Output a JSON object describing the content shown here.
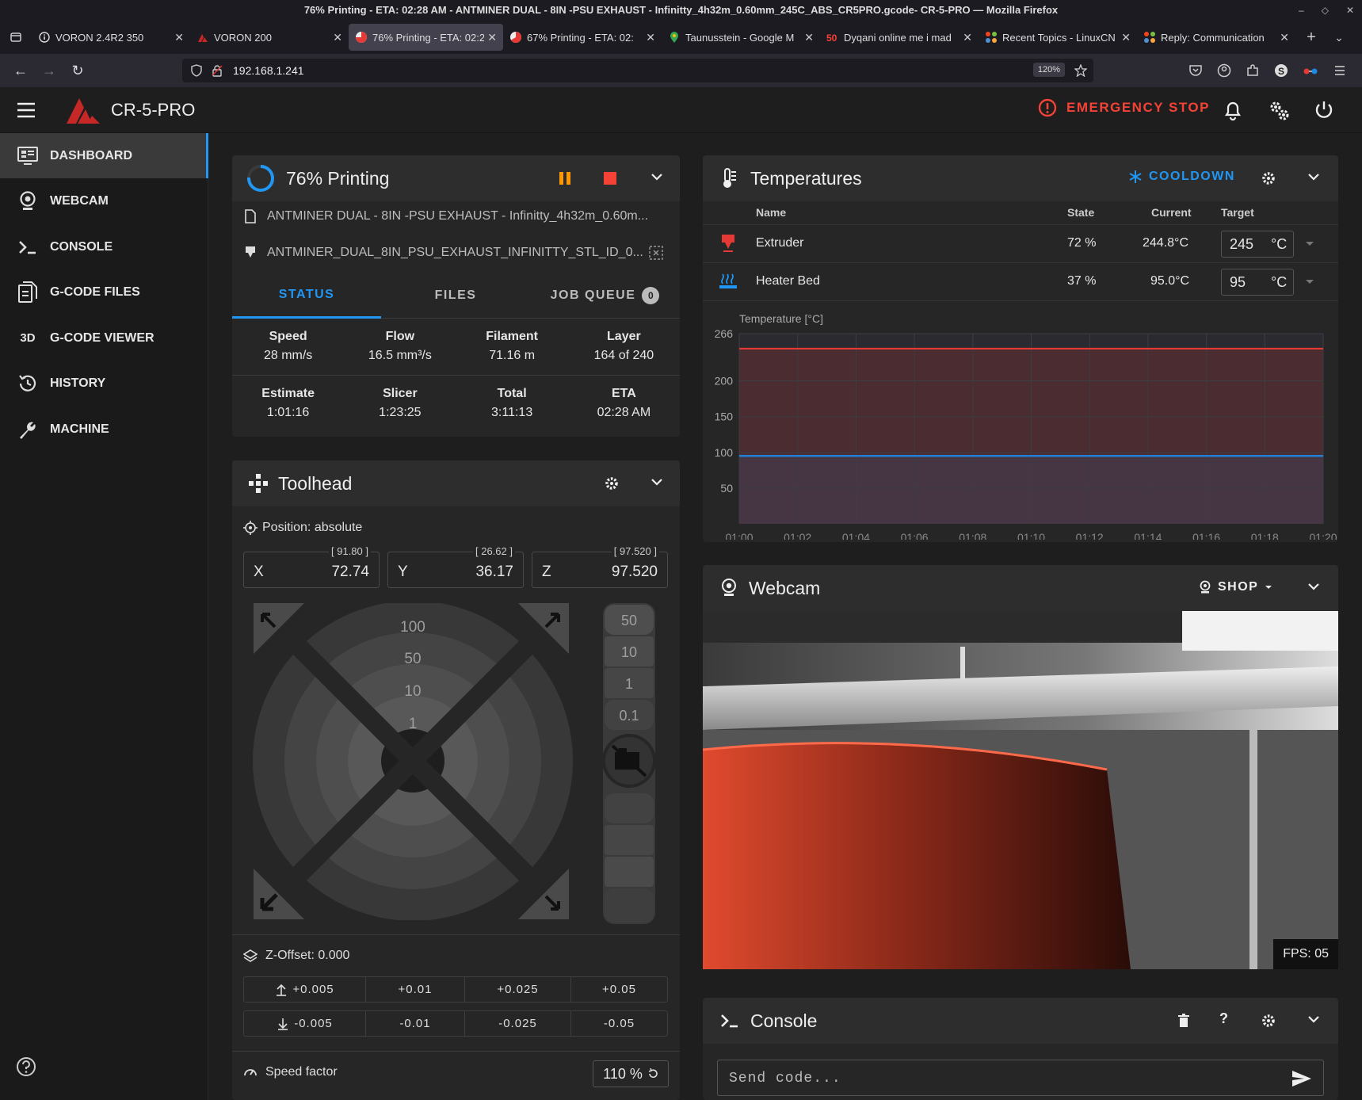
{
  "browser": {
    "window_title": "76% Printing - ETA: 02:28 AM - ANTMINER DUAL - 8IN -PSU EXHAUST - Infinitty_4h32m_0.60mm_245C_ABS_CR5PRO.gcode- CR-5-PRO — Mozilla Firefox",
    "tabs": [
      {
        "label": "VORON 2.4R2 350"
      },
      {
        "label": "VORON 200"
      },
      {
        "label": "76% Printing - ETA: 02:2"
      },
      {
        "label": "67% Printing - ETA: 02:"
      },
      {
        "label": "Taunusstein - Google M"
      },
      {
        "label": "Dyqani online me i mad"
      },
      {
        "label": "Recent Topics - LinuxCN"
      },
      {
        "label": "Reply: Communication"
      }
    ],
    "url": "192.168.1.241",
    "zoom": "120%"
  },
  "app": {
    "title": "CR-5-PRO",
    "emergency_stop": "EMERGENCY STOP"
  },
  "sidebar": {
    "items": [
      {
        "label": "DASHBOARD"
      },
      {
        "label": "WEBCAM"
      },
      {
        "label": "CONSOLE"
      },
      {
        "label": "G-CODE FILES"
      },
      {
        "label": "G-CODE VIEWER"
      },
      {
        "label": "HISTORY"
      },
      {
        "label": "MACHINE"
      }
    ],
    "viewer_icon_text": "3D"
  },
  "status": {
    "title": "76% Printing",
    "progress": 0.76,
    "file": "ANTMINER DUAL - 8IN -PSU EXHAUST - Infinitty_4h32m_0.60m...",
    "object": "ANTMINER_DUAL_8IN_PSU_EXHAUST_INFINITTY_STL_ID_0...",
    "tabs": {
      "status": "STATUS",
      "files": "FILES",
      "queue": "JOB QUEUE",
      "queue_count": "0"
    },
    "stats1": [
      {
        "label": "Speed",
        "value": "28 mm/s"
      },
      {
        "label": "Flow",
        "value": "16.5 mm³/s"
      },
      {
        "label": "Filament",
        "value": "71.16 m"
      },
      {
        "label": "Layer",
        "value": "164 of 240"
      }
    ],
    "stats2": [
      {
        "label": "Estimate",
        "value": "1:01:16"
      },
      {
        "label": "Slicer",
        "value": "1:23:25"
      },
      {
        "label": "Total",
        "value": "3:11:13"
      },
      {
        "label": "ETA",
        "value": "02:28 AM"
      }
    ]
  },
  "toolhead": {
    "title": "Toolhead",
    "position_mode": "Position: absolute",
    "axes": [
      {
        "label": "X",
        "value": "72.74",
        "pos": "[ 91.80 ]"
      },
      {
        "label": "Y",
        "value": "36.17",
        "pos": "[ 26.62 ]"
      },
      {
        "label": "Z",
        "value": "97.520",
        "pos": "[ 97.520 ]"
      }
    ],
    "xy_steps": [
      "100",
      "50",
      "10",
      "1"
    ],
    "z_steps": [
      "50",
      "10",
      "1",
      "0.1"
    ],
    "zoffset": "Z-Offset: 0.000",
    "zoffset_up": [
      "+0.005",
      "+0.01",
      "+0.025",
      "+0.05"
    ],
    "zoffset_down": [
      "-0.005",
      "-0.01",
      "-0.025",
      "-0.05"
    ],
    "speed_factor_label": "Speed factor",
    "speed_factor": "110 %"
  },
  "temperatures": {
    "title": "Temperatures",
    "cooldown": "COOLDOWN",
    "columns": {
      "name": "Name",
      "state": "State",
      "current": "Current",
      "target": "Target"
    },
    "heaters": [
      {
        "name": "Extruder",
        "state": "72 %",
        "current": "244.8°C",
        "target": "245",
        "unit": "°C"
      },
      {
        "name": "Heater Bed",
        "state": "37 %",
        "current": "95.0°C",
        "target": "95",
        "unit": "°C"
      }
    ]
  },
  "chart_data": {
    "type": "line",
    "ylabel": "Temperature [°C]",
    "yticks": [
      266,
      200,
      150,
      100,
      50
    ],
    "ylim": [
      0,
      266
    ],
    "xticks": [
      "01:00",
      "01:02",
      "01:04",
      "01:06",
      "01:08",
      "01:10",
      "01:12",
      "01:14",
      "01:16",
      "01:18",
      "01:20"
    ],
    "grid": true,
    "series": [
      {
        "color": "#e53935",
        "values": [
          245,
          245,
          245,
          245,
          245,
          245,
          245,
          245,
          245,
          245,
          245
        ]
      },
      {
        "color": "#1e88e5",
        "values": [
          95,
          95,
          95,
          95,
          95,
          95,
          95,
          95,
          95,
          95,
          95
        ]
      }
    ]
  },
  "webcam": {
    "title": "Webcam",
    "camera": "SHOP",
    "fps": "FPS: 05"
  },
  "console": {
    "title": "Console",
    "placeholder": "Send code..."
  },
  "colors": {
    "accent": "#2196f3",
    "estop": "#f44336",
    "pause": "#ff9800",
    "stop": "#f44336"
  }
}
